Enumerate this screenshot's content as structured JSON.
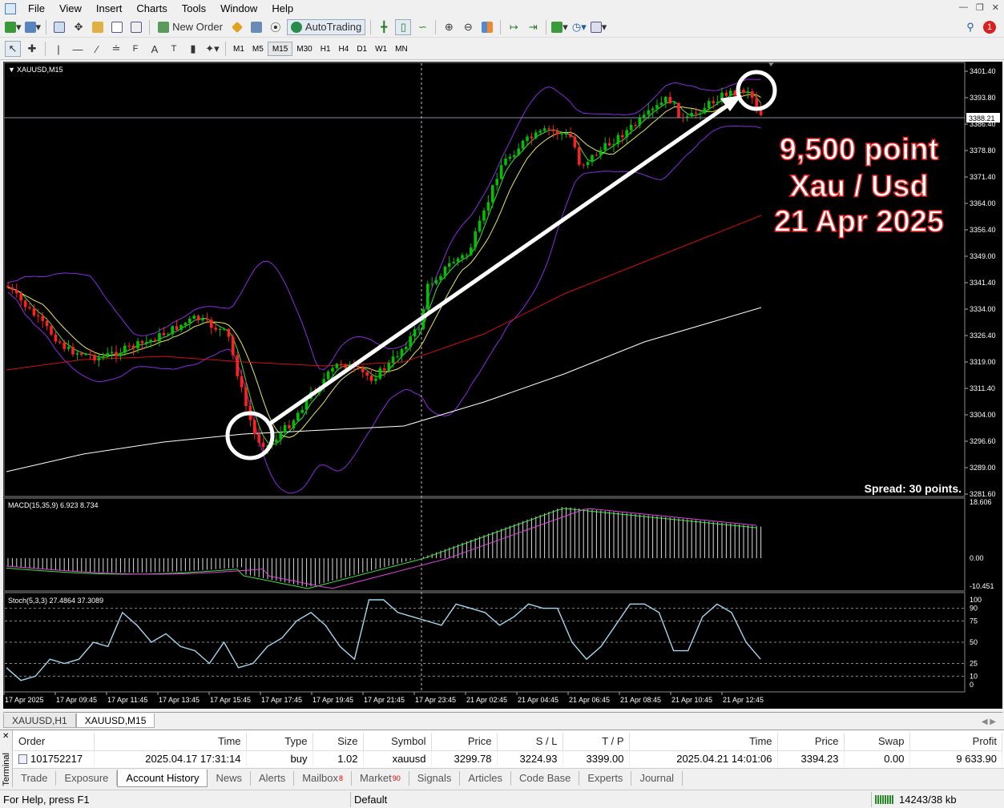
{
  "menu": [
    "File",
    "View",
    "Insert",
    "Charts",
    "Tools",
    "Window",
    "Help"
  ],
  "toolbar": {
    "new_order": "New Order",
    "autotrading": "AutoTrading",
    "timeframes": [
      "M1",
      "M5",
      "M15",
      "M30",
      "H1",
      "H4",
      "D1",
      "W1",
      "MN"
    ],
    "active_timeframe": "M15",
    "notification_count": "1"
  },
  "chart": {
    "symbol_label": "XAUUSD,M15",
    "current_price": "3388.21",
    "spread": "Spread: 30 points.",
    "annotation": [
      "9,500 point",
      "Xau / Usd",
      "21 Apr 2025"
    ],
    "price_ticks": [
      "3401.40",
      "3393.80",
      "3386.40",
      "3378.80",
      "3371.40",
      "3364.00",
      "3356.40",
      "3349.00",
      "3341.40",
      "3334.00",
      "3326.40",
      "3319.00",
      "3311.40",
      "3304.00",
      "3296.60",
      "3289.00",
      "3281.60"
    ],
    "time_ticks": [
      "17 Apr 2025",
      "17 Apr 09:45",
      "17 Apr 11:45",
      "17 Apr 13:45",
      "17 Apr 15:45",
      "17 Apr 17:45",
      "17 Apr 19:45",
      "17 Apr 21:45",
      "17 Apr 23:45",
      "21 Apr 02:45",
      "21 Apr 04:45",
      "21 Apr 06:45",
      "21 Apr 08:45",
      "21 Apr 10:45",
      "21 Apr 12:45"
    ],
    "macd_label": "MACD(15,35,9) 6.923 8.734",
    "macd_ticks": [
      "18.606",
      "0.00",
      "-10.451"
    ],
    "stoch_label": "Stoch(5,3,3) 27.4864 37.3089",
    "stoch_ticks": [
      "100",
      "90",
      "75",
      "50",
      "25",
      "10",
      "0"
    ],
    "colors": {
      "bull": "#00c000",
      "bear": "#ff2020",
      "bands": "#8a2be2",
      "ma_red": "#d01010",
      "ma_white": "#ffffff",
      "ma_yellow": "#e8e860",
      "ma_green": "#40e040",
      "stoch": "#a0d8f0"
    }
  },
  "chart_data": {
    "type": "candlestick",
    "symbol": "XAUUSD",
    "timeframe": "M15",
    "ylim": [
      3281.6,
      3401.4
    ],
    "trade_entry": {
      "time": "17 Apr 17:31",
      "price": 3299.78
    },
    "trade_exit": {
      "time": "21 Apr 14:01",
      "price": 3394.23
    }
  },
  "chart_tabs": [
    "XAUUSD,H1",
    "XAUUSD,M15"
  ],
  "history": {
    "columns": [
      "Order",
      "Time",
      "Type",
      "Size",
      "Symbol",
      "Price",
      "S / L",
      "T / P",
      "Time",
      "Price",
      "Swap",
      "Profit"
    ],
    "row": [
      "101752217",
      "2025.04.17 17:31:14",
      "buy",
      "1.02",
      "xauusd",
      "3299.78",
      "3224.93",
      "3399.00",
      "2025.04.21 14:01:06",
      "3394.23",
      "0.00",
      "9 633.90"
    ]
  },
  "terminal_label": "Terminal",
  "terminal_tabs": [
    {
      "label": "Trade",
      "badge": ""
    },
    {
      "label": "Exposure",
      "badge": ""
    },
    {
      "label": "Account History",
      "badge": ""
    },
    {
      "label": "News",
      "badge": ""
    },
    {
      "label": "Alerts",
      "badge": ""
    },
    {
      "label": "Mailbox",
      "badge": "8"
    },
    {
      "label": "Market",
      "badge": "90"
    },
    {
      "label": "Signals",
      "badge": ""
    },
    {
      "label": "Articles",
      "badge": ""
    },
    {
      "label": "Code Base",
      "badge": ""
    },
    {
      "label": "Experts",
      "badge": ""
    },
    {
      "label": "Journal",
      "badge": ""
    }
  ],
  "status": {
    "help": "For Help, press F1",
    "profile": "Default",
    "traffic": "14243/38 kb"
  }
}
